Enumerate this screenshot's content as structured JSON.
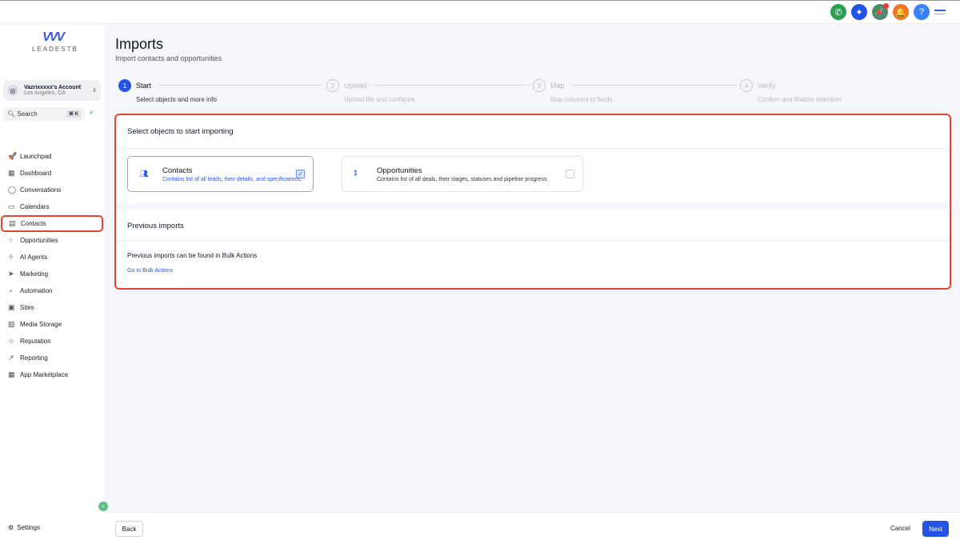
{
  "topbar": {
    "icons": [
      {
        "name": "phone-icon",
        "glyph": "✆",
        "color": "#2e9d55"
      },
      {
        "name": "sparkle-icon",
        "glyph": "✦",
        "color": "#2454e6"
      },
      {
        "name": "megaphone-icon",
        "glyph": "📣",
        "color": "#4b8c6b"
      },
      {
        "name": "bell-icon",
        "glyph": "🔔",
        "color": "#f07427"
      },
      {
        "name": "help-icon",
        "glyph": "?",
        "color": "#3b82f6"
      }
    ]
  },
  "sidebar": {
    "logo_text": "LEADESTB",
    "account_name": "Vazrixxxxx's Account",
    "account_location": "Los Angeles, CA",
    "search_label": "Search",
    "shortcut": "⌘ K",
    "items": [
      {
        "label": "Launchpad",
        "icon": "🚀"
      },
      {
        "label": "Dashboard",
        "icon": "▦"
      },
      {
        "label": "Conversations",
        "icon": "◯"
      },
      {
        "label": "Calendars",
        "icon": "▭"
      },
      {
        "label": "Contacts",
        "icon": "▤"
      },
      {
        "label": "Opportunities",
        "icon": "⁘"
      },
      {
        "label": "AI Agents",
        "icon": "✧"
      },
      {
        "label": "Marketing",
        "icon": "➤"
      },
      {
        "label": "Automation",
        "icon": "◔"
      },
      {
        "label": "Sites",
        "icon": "▣"
      },
      {
        "label": "Media Storage",
        "icon": "▨"
      },
      {
        "label": "Reputation",
        "icon": "☆"
      },
      {
        "label": "Reporting",
        "icon": "↗"
      },
      {
        "label": "App Marketplace",
        "icon": "▦"
      }
    ],
    "settings_label": "Settings"
  },
  "page": {
    "title": "Imports",
    "subtitle": "Import contacts and opportunities"
  },
  "steps": [
    {
      "num": "1",
      "label": "Start",
      "desc": "Select objects and more info"
    },
    {
      "num": "2",
      "label": "Upload",
      "desc": "Upload file and configure"
    },
    {
      "num": "3",
      "label": "Map",
      "desc": "Map columns to fields"
    },
    {
      "num": "4",
      "label": "Verify",
      "desc": "Confirm and finalize selection"
    }
  ],
  "select": {
    "title": "Select objects to start importing",
    "cards": [
      {
        "title": "Contacts",
        "desc": "Contains list of all leads, their details, and specifications.",
        "checked": true
      },
      {
        "title": "Opportunities",
        "desc": "Contains list of all deals, their stages, statuses and pipeline progress.",
        "checked": false
      }
    ]
  },
  "previous": {
    "title": "Previous imports",
    "text": "Previous imports can be found in Bulk Actions",
    "link": "Go to Bulk Actions"
  },
  "footer": {
    "back": "Back",
    "cancel": "Cancel",
    "next": "Next"
  }
}
